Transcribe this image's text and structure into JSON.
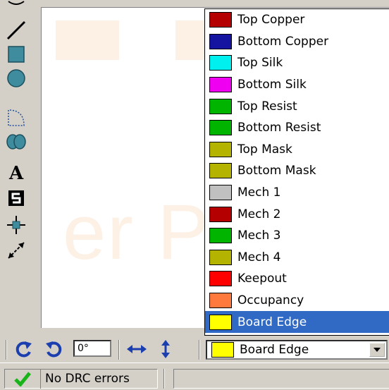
{
  "tools": [
    {
      "name": "line-tool-icon"
    },
    {
      "name": "rectangle-tool-icon"
    },
    {
      "name": "circle-tool-icon"
    },
    {
      "name": "arc-tool-icon"
    },
    {
      "name": "pad-tool-icon"
    },
    {
      "name": "text-tool-icon"
    },
    {
      "name": "symbol-tool-icon"
    },
    {
      "name": "origin-tool-icon"
    },
    {
      "name": "dimension-tool-icon"
    }
  ],
  "layers": [
    {
      "label": "Top Copper",
      "color": "#b40000"
    },
    {
      "label": "Bottom Copper",
      "color": "#1414a0"
    },
    {
      "label": "Top Silk",
      "color": "#00f0f0"
    },
    {
      "label": "Bottom Silk",
      "color": "#f000f0"
    },
    {
      "label": "Top Resist",
      "color": "#00b400"
    },
    {
      "label": "Bottom Resist",
      "color": "#00b400"
    },
    {
      "label": "Top Mask",
      "color": "#b4b400"
    },
    {
      "label": "Bottom Mask",
      "color": "#b4b400"
    },
    {
      "label": "Mech 1",
      "color": "#c0c0c0"
    },
    {
      "label": "Mech 2",
      "color": "#b40000"
    },
    {
      "label": "Mech 3",
      "color": "#00b400"
    },
    {
      "label": "Mech 4",
      "color": "#b4b400"
    },
    {
      "label": "Keepout",
      "color": "#ff0000"
    },
    {
      "label": "Occupancy",
      "color": "#ff7a3c"
    },
    {
      "label": "Board Edge",
      "color": "#ffff00",
      "selected": true
    }
  ],
  "toolbar": {
    "rotate_cw_icon": "rotate-clockwise-icon",
    "rotate_ccw_icon": "rotate-counterclockwise-icon",
    "angle_value": "0°",
    "flip_h_icon": "flip-horizontal-icon",
    "flip_v_icon": "flip-vertical-icon",
    "current_layer": "Board Edge",
    "current_layer_color": "#ffff00"
  },
  "status": {
    "drc_text": "No DRC errors",
    "drc_icon": "checkmark-icon",
    "check_color": "#19b419"
  }
}
